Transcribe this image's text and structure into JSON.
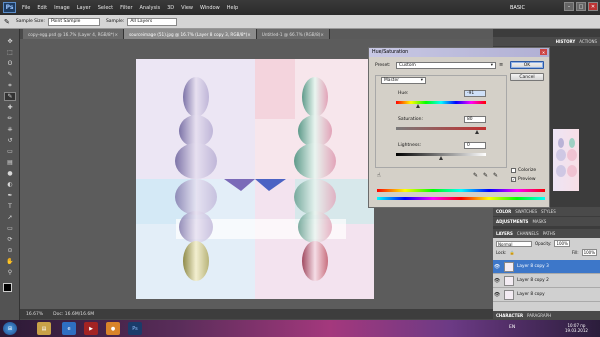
{
  "app": {
    "logo": "Ps",
    "workspace": "BASIC"
  },
  "menu": [
    "File",
    "Edit",
    "Image",
    "Layer",
    "Select",
    "Filter",
    "Analysis",
    "3D",
    "View",
    "Window",
    "Help"
  ],
  "options_bar": {
    "sample_size_label": "Sample Size:",
    "sample_size_value": "Point Sample",
    "sample_label": "Sample:",
    "sample_value": "All Layers"
  },
  "doc_tabs": [
    {
      "label": "copy-egg.psd @ 16.7% (Layer 4, RGB/8*)",
      "active": false
    },
    {
      "label": "sourceimage (51).jpg @ 16.7% (Layer 8 copy 3, RGB/8*)",
      "active": true
    },
    {
      "label": "Untitled-1 @ 66.7% (RGB/8)",
      "active": false
    }
  ],
  "statusbar": {
    "zoom": "16.67%",
    "doc": "Doc: 16.6M/16.6M"
  },
  "dialog": {
    "title": "Hue/Saturation",
    "preset_label": "Preset:",
    "preset_value": "Custom",
    "channel": "Master",
    "hue_label": "Hue:",
    "hue_value": "-91",
    "saturation_label": "Saturation:",
    "saturation_value": "80",
    "lightness_label": "Lightness:",
    "lightness_value": "0",
    "ok": "OK",
    "cancel": "Cancel",
    "colorize_label": "Colorize",
    "preview_label": "Preview",
    "colorize_checked": false,
    "preview_checked": true
  },
  "panels": {
    "history_tabs": [
      "HISTORY",
      "ACTIONS"
    ],
    "color_tabs": [
      "COLOR",
      "SWATCHES",
      "STYLES"
    ],
    "adjust_tabs": [
      "ADJUSTMENTS",
      "MASKS"
    ],
    "layers_tabs": [
      "LAYERS",
      "CHANNELS",
      "PATHS"
    ],
    "blend_mode": "Normal",
    "opacity_label": "Opacity:",
    "opacity_value": "100%",
    "lock_label": "Lock:",
    "fill_label": "Fill:",
    "fill_value": "100%",
    "layers": [
      {
        "name": "Layer 8 copy 3",
        "selected": true
      },
      {
        "name": "Layer 8 copy 2",
        "selected": false
      },
      {
        "name": "Layer 8 copy",
        "selected": false
      }
    ],
    "bottom_tabs": [
      "CHARACTER",
      "PARAGRAPH"
    ]
  },
  "taskbar": {
    "lang": "EN",
    "time": "10:07 пр",
    "date": "19.03.2012"
  }
}
